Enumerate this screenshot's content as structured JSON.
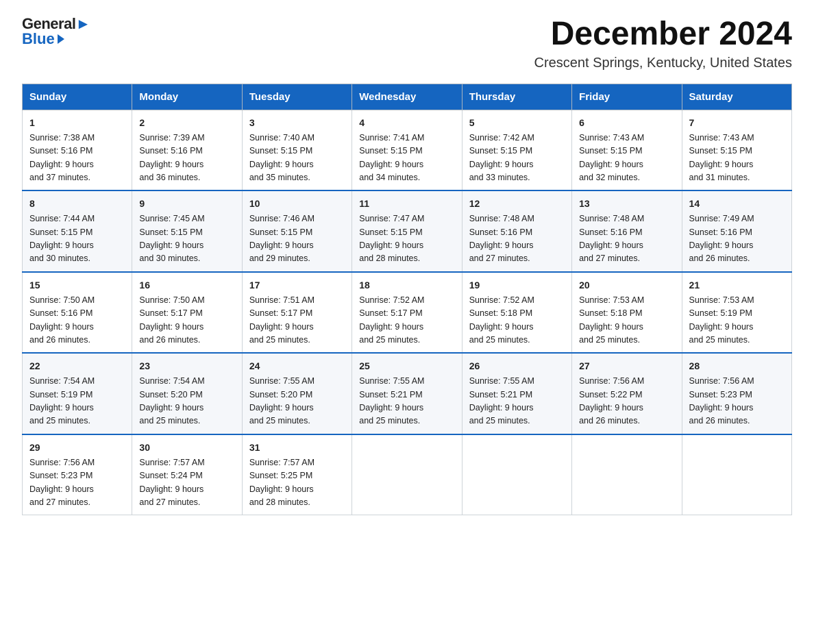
{
  "logo": {
    "general": "General",
    "blue": "Blue"
  },
  "title": "December 2024",
  "location": "Crescent Springs, Kentucky, United States",
  "days_of_week": [
    "Sunday",
    "Monday",
    "Tuesday",
    "Wednesday",
    "Thursday",
    "Friday",
    "Saturday"
  ],
  "weeks": [
    [
      {
        "day": "1",
        "sunrise": "7:38 AM",
        "sunset": "5:16 PM",
        "daylight": "9 hours and 37 minutes."
      },
      {
        "day": "2",
        "sunrise": "7:39 AM",
        "sunset": "5:16 PM",
        "daylight": "9 hours and 36 minutes."
      },
      {
        "day": "3",
        "sunrise": "7:40 AM",
        "sunset": "5:15 PM",
        "daylight": "9 hours and 35 minutes."
      },
      {
        "day": "4",
        "sunrise": "7:41 AM",
        "sunset": "5:15 PM",
        "daylight": "9 hours and 34 minutes."
      },
      {
        "day": "5",
        "sunrise": "7:42 AM",
        "sunset": "5:15 PM",
        "daylight": "9 hours and 33 minutes."
      },
      {
        "day": "6",
        "sunrise": "7:43 AM",
        "sunset": "5:15 PM",
        "daylight": "9 hours and 32 minutes."
      },
      {
        "day": "7",
        "sunrise": "7:43 AM",
        "sunset": "5:15 PM",
        "daylight": "9 hours and 31 minutes."
      }
    ],
    [
      {
        "day": "8",
        "sunrise": "7:44 AM",
        "sunset": "5:15 PM",
        "daylight": "9 hours and 30 minutes."
      },
      {
        "day": "9",
        "sunrise": "7:45 AM",
        "sunset": "5:15 PM",
        "daylight": "9 hours and 30 minutes."
      },
      {
        "day": "10",
        "sunrise": "7:46 AM",
        "sunset": "5:15 PM",
        "daylight": "9 hours and 29 minutes."
      },
      {
        "day": "11",
        "sunrise": "7:47 AM",
        "sunset": "5:15 PM",
        "daylight": "9 hours and 28 minutes."
      },
      {
        "day": "12",
        "sunrise": "7:48 AM",
        "sunset": "5:16 PM",
        "daylight": "9 hours and 27 minutes."
      },
      {
        "day": "13",
        "sunrise": "7:48 AM",
        "sunset": "5:16 PM",
        "daylight": "9 hours and 27 minutes."
      },
      {
        "day": "14",
        "sunrise": "7:49 AM",
        "sunset": "5:16 PM",
        "daylight": "9 hours and 26 minutes."
      }
    ],
    [
      {
        "day": "15",
        "sunrise": "7:50 AM",
        "sunset": "5:16 PM",
        "daylight": "9 hours and 26 minutes."
      },
      {
        "day": "16",
        "sunrise": "7:50 AM",
        "sunset": "5:17 PM",
        "daylight": "9 hours and 26 minutes."
      },
      {
        "day": "17",
        "sunrise": "7:51 AM",
        "sunset": "5:17 PM",
        "daylight": "9 hours and 25 minutes."
      },
      {
        "day": "18",
        "sunrise": "7:52 AM",
        "sunset": "5:17 PM",
        "daylight": "9 hours and 25 minutes."
      },
      {
        "day": "19",
        "sunrise": "7:52 AM",
        "sunset": "5:18 PM",
        "daylight": "9 hours and 25 minutes."
      },
      {
        "day": "20",
        "sunrise": "7:53 AM",
        "sunset": "5:18 PM",
        "daylight": "9 hours and 25 minutes."
      },
      {
        "day": "21",
        "sunrise": "7:53 AM",
        "sunset": "5:19 PM",
        "daylight": "9 hours and 25 minutes."
      }
    ],
    [
      {
        "day": "22",
        "sunrise": "7:54 AM",
        "sunset": "5:19 PM",
        "daylight": "9 hours and 25 minutes."
      },
      {
        "day": "23",
        "sunrise": "7:54 AM",
        "sunset": "5:20 PM",
        "daylight": "9 hours and 25 minutes."
      },
      {
        "day": "24",
        "sunrise": "7:55 AM",
        "sunset": "5:20 PM",
        "daylight": "9 hours and 25 minutes."
      },
      {
        "day": "25",
        "sunrise": "7:55 AM",
        "sunset": "5:21 PM",
        "daylight": "9 hours and 25 minutes."
      },
      {
        "day": "26",
        "sunrise": "7:55 AM",
        "sunset": "5:21 PM",
        "daylight": "9 hours and 25 minutes."
      },
      {
        "day": "27",
        "sunrise": "7:56 AM",
        "sunset": "5:22 PM",
        "daylight": "9 hours and 26 minutes."
      },
      {
        "day": "28",
        "sunrise": "7:56 AM",
        "sunset": "5:23 PM",
        "daylight": "9 hours and 26 minutes."
      }
    ],
    [
      {
        "day": "29",
        "sunrise": "7:56 AM",
        "sunset": "5:23 PM",
        "daylight": "9 hours and 27 minutes."
      },
      {
        "day": "30",
        "sunrise": "7:57 AM",
        "sunset": "5:24 PM",
        "daylight": "9 hours and 27 minutes."
      },
      {
        "day": "31",
        "sunrise": "7:57 AM",
        "sunset": "5:25 PM",
        "daylight": "9 hours and 28 minutes."
      },
      null,
      null,
      null,
      null
    ]
  ],
  "labels": {
    "sunrise": "Sunrise:",
    "sunset": "Sunset:",
    "daylight": "Daylight:"
  }
}
